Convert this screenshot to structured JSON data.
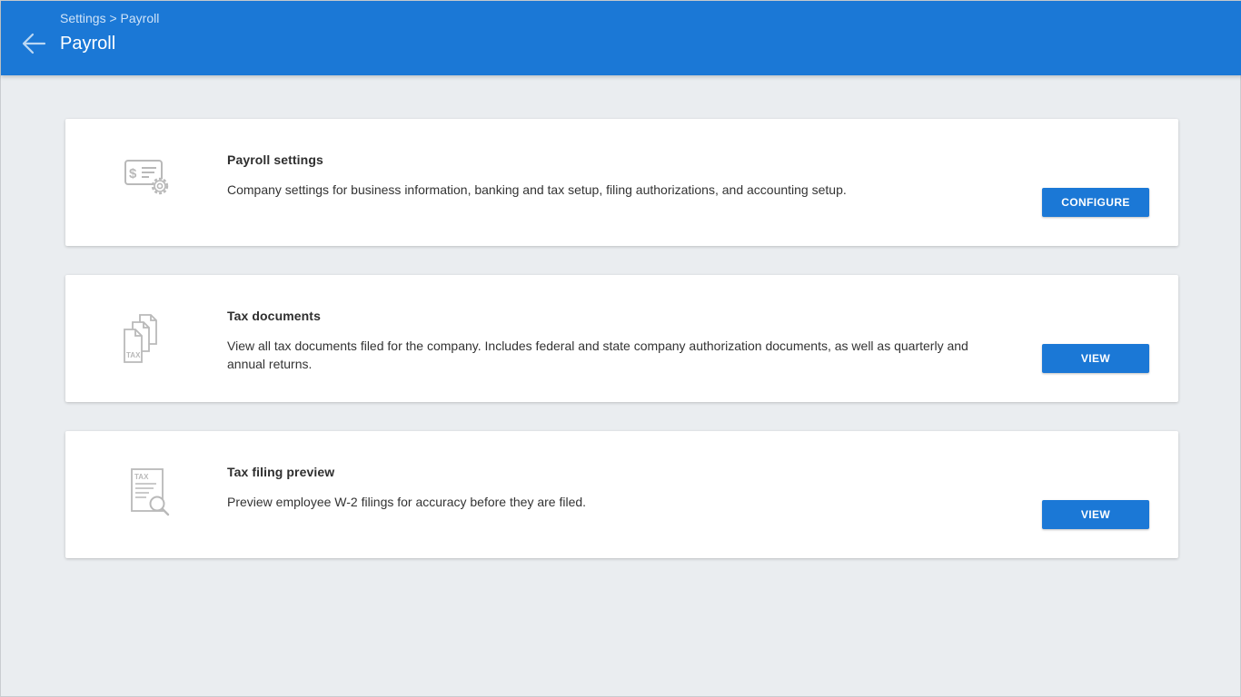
{
  "header": {
    "breadcrumb": "Settings > Payroll",
    "title": "Payroll",
    "back_icon": "arrow-back-icon"
  },
  "theme": {
    "accent": "#1b78d6",
    "background": "#eaedf0",
    "icon_gray": "#b9b9b9"
  },
  "cards": [
    {
      "icon": "payroll-settings-icon",
      "title": "Payroll settings",
      "description": "Company settings for business information, banking and tax setup, filing authorizations, and accounting setup.",
      "button_label": "CONFIGURE"
    },
    {
      "icon": "tax-documents-icon",
      "icon_text": "TAX",
      "title": "Tax documents",
      "description": "View all tax documents filed for the company. Includes federal and state company authorization documents, as well as quarterly and annual returns.",
      "button_label": "VIEW"
    },
    {
      "icon": "tax-filing-preview-icon",
      "icon_text": "TAX",
      "title": "Tax filing preview",
      "description": "Preview employee W-2 filings for accuracy before they are filed.",
      "button_label": "VIEW"
    }
  ]
}
